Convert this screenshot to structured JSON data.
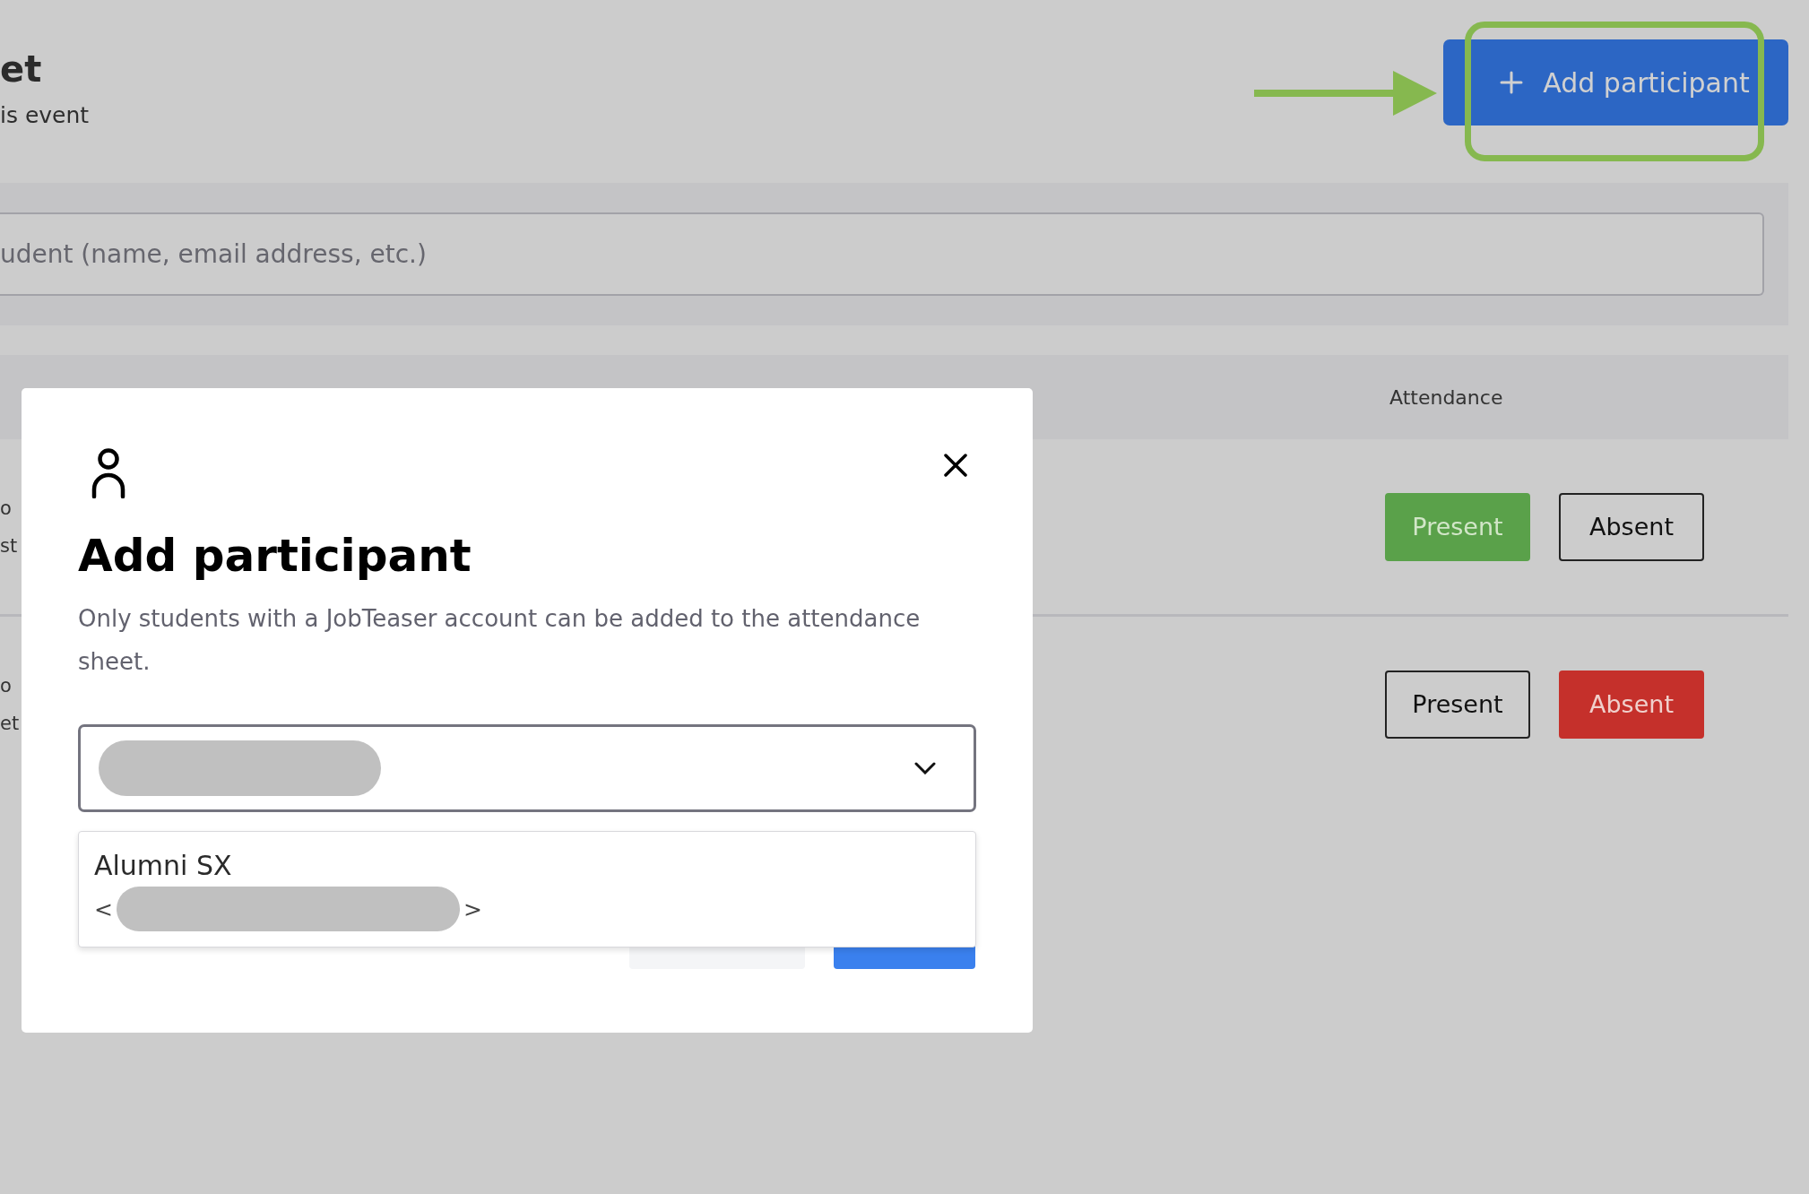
{
  "page": {
    "title": "et",
    "subtitle": "is event",
    "add_button": {
      "label": "Add participant"
    }
  },
  "search": {
    "placeholder": "udent (name, email address, etc.)"
  },
  "table": {
    "columns": [
      "Attendance"
    ],
    "rows": [
      {
        "cell_1": "o",
        "cell_2": "st",
        "buttons": [
          {
            "kind": "present",
            "label": "Present",
            "selected": true
          },
          {
            "kind": "absent",
            "label": "Absent",
            "selected": false
          }
        ]
      },
      {
        "cell_1": "o",
        "cell_2": "et",
        "buttons": [
          {
            "kind": "present",
            "label": "Present",
            "selected": false
          },
          {
            "kind": "absent",
            "label": "Absent",
            "selected": true
          }
        ]
      }
    ]
  },
  "modal": {
    "title": "Add participant",
    "description": "Only students with a JobTeaser account can be added to the attendance sheet.",
    "options": [
      {
        "name": "Alumni SX",
        "email_start": "<",
        "email_end": ">"
      }
    ]
  }
}
